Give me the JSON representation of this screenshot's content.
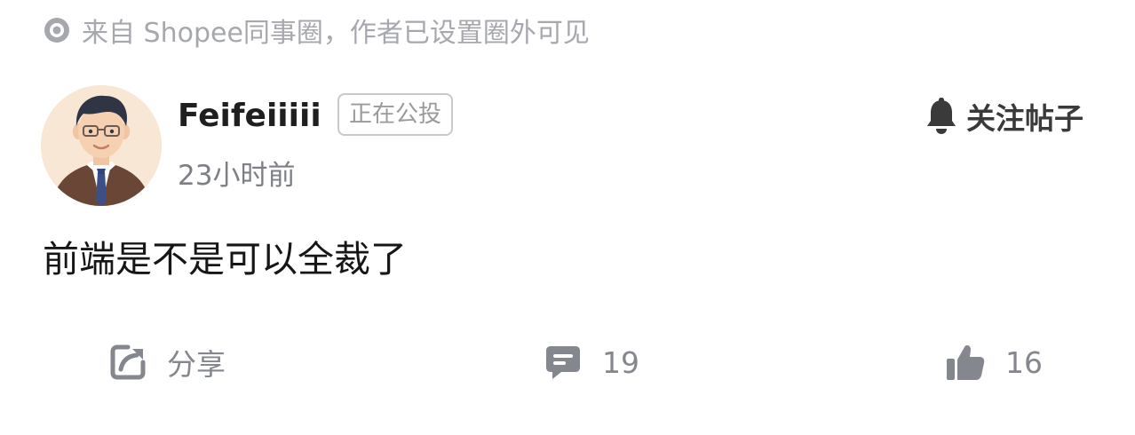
{
  "source": {
    "text": "来自 Shopee同事圈，作者已设置圈外可见",
    "icon": "circle-dot-icon"
  },
  "author": {
    "name": "Feifeiiiii",
    "badge": "正在公投",
    "time": "23小时前",
    "avatar": "avatar-man-glasses-suit"
  },
  "follow": {
    "label": "关注帖子",
    "icon": "bell-icon"
  },
  "post": {
    "body": "前端是不是可以全裁了"
  },
  "actions": {
    "share": {
      "label": "分享",
      "icon": "share-icon"
    },
    "comment": {
      "count": "19",
      "icon": "comment-icon"
    },
    "like": {
      "count": "16",
      "icon": "thumbs-up-icon"
    }
  },
  "colors": {
    "muted": "#a6a8ad",
    "icon_gray": "#84878d",
    "text": "#1f1f1f"
  }
}
